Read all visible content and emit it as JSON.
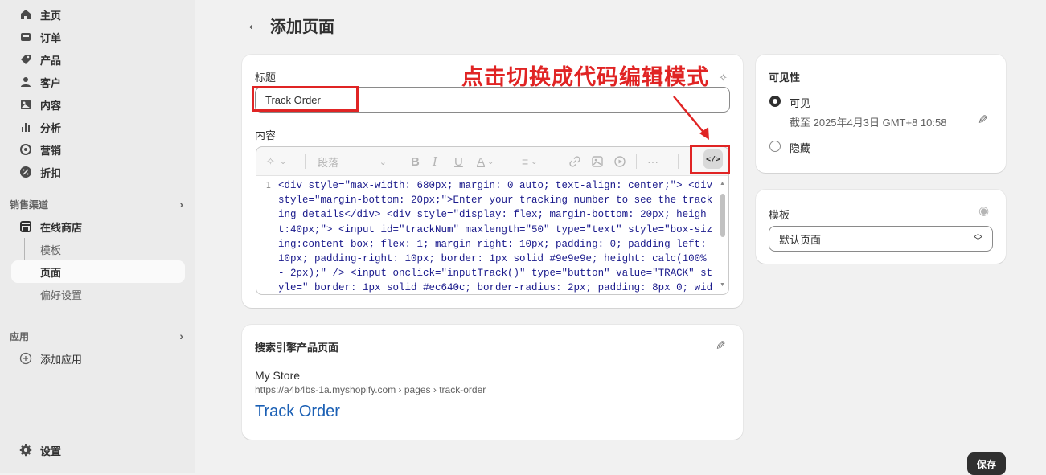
{
  "sidebar": {
    "items": [
      {
        "label": "主页",
        "icon": "home-icon"
      },
      {
        "label": "订单",
        "icon": "inbox-icon"
      },
      {
        "label": "产品",
        "icon": "tag-icon"
      },
      {
        "label": "客户",
        "icon": "person-icon"
      },
      {
        "label": "内容",
        "icon": "image-icon"
      },
      {
        "label": "分析",
        "icon": "bar-chart-icon"
      },
      {
        "label": "营销",
        "icon": "target-icon"
      },
      {
        "label": "折扣",
        "icon": "discount-icon"
      }
    ],
    "sales_channels_label": "销售渠道",
    "online_store": {
      "label": "在线商店",
      "icon": "store-icon"
    },
    "online_store_sub": [
      {
        "label": "模板"
      },
      {
        "label": "页面"
      },
      {
        "label": "偏好设置"
      }
    ],
    "apps_label": "应用",
    "add_app": {
      "label": "添加应用",
      "icon": "plus-circle-icon"
    },
    "settings": {
      "label": "设置",
      "icon": "gear-icon"
    }
  },
  "header": {
    "title": "添加页面"
  },
  "editor": {
    "title_label": "标题",
    "title_value": "Track Order",
    "content_label": "内容",
    "paragraph_label": "段落",
    "annotation": "点击切换成代码编辑模式",
    "code_button_label": "</>",
    "line_number": "1",
    "code": "<div style=\"max-width: 680px; margin: 0 auto; text-align: center;\"> <div style=\"margin-bottom: 20px;\">Enter your tracking number to see the tracking details</div> <div style=\"display: flex; margin-bottom: 20px; height:40px;\"> <input id=\"trackNum\" maxlength=\"50\" type=\"text\" style=\"box-sizing:content-box; flex: 1; margin-right: 10px; padding: 0; padding-left: 10px; padding-right: 10px; border: 1px solid #9e9e9e; height: calc(100% - 2px);\" /> <input onclick=\"inputTrack()\" type=\"button\" value=\"TRACK\" style=\" border: 1px solid #ec640c; border-radius: 2px; padding: 8px 0; width: 80px; height: 100%;"
  },
  "seo": {
    "title": "搜索引擎产品页面",
    "store_name": "My Store",
    "url": "https://a4b4bs-1a.myshopify.com › pages › track-order",
    "page_title": "Track Order",
    "link_color": "#1a5fb4"
  },
  "visibility": {
    "title": "可见性",
    "visible_label": "可见",
    "visible_date": "截至 2025年4月3日 GMT+8 10:58",
    "hidden_label": "隐藏",
    "selected": "可见"
  },
  "template": {
    "title": "模板",
    "selected": "默认页面"
  },
  "footer": {
    "save_label": "保存"
  },
  "colors": {
    "annotation_red": "#e02424",
    "sidebar_bg": "#ebebeb",
    "page_bg": "#f1f1f1"
  }
}
